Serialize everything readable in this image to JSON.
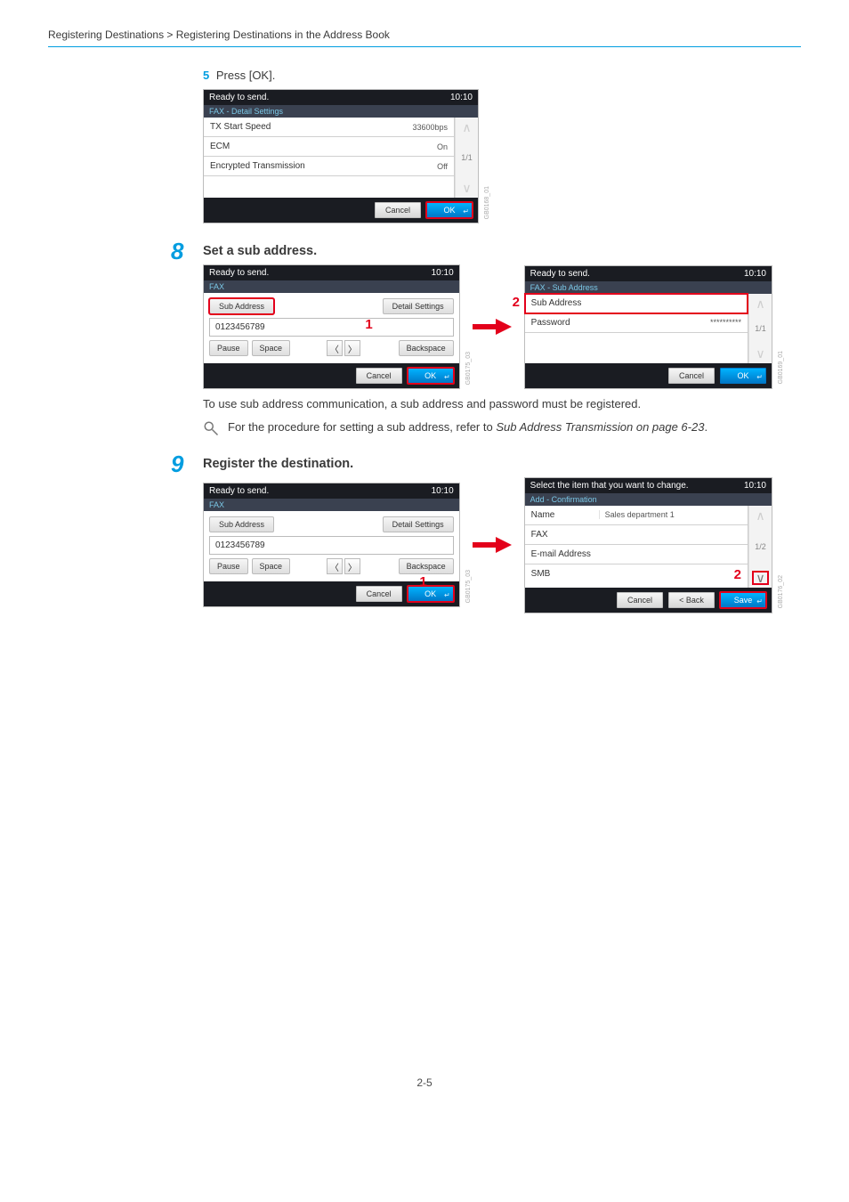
{
  "breadcrumb": "Registering Destinations > Registering Destinations in the Address Book",
  "step5": {
    "num": "5",
    "text": "Press [OK]."
  },
  "panelA": {
    "status": "Ready to send.",
    "time": "10:10",
    "subtitle": "FAX - Detail Settings",
    "rows": [
      {
        "label": "TX Start Speed",
        "value": "33600bps"
      },
      {
        "label": "ECM",
        "value": "On"
      },
      {
        "label": "Encrypted Transmission",
        "value": "Off"
      }
    ],
    "page": "1/1",
    "cancel": "Cancel",
    "ok": "OK",
    "side_tag": "GB0168_01"
  },
  "step8": {
    "num": "8",
    "title": "Set a sub address."
  },
  "panelB": {
    "status": "Ready to send.",
    "time": "10:10",
    "subtitle": "FAX",
    "tab_sub": "Sub Address",
    "tab_detail": "Detail Settings",
    "input": "0123456789",
    "pause": "Pause",
    "space": "Space",
    "backspace": "Backspace",
    "cancel": "Cancel",
    "ok": "OK",
    "side_tag": "GB0175_03",
    "callout": "1"
  },
  "panelC": {
    "status": "Ready to send.",
    "time": "10:10",
    "subtitle": "FAX - Sub Address",
    "rows": [
      {
        "label": "Sub Address",
        "value": ""
      },
      {
        "label": "Password",
        "value": "**********"
      }
    ],
    "page": "1/1",
    "cancel": "Cancel",
    "ok": "OK",
    "side_tag": "GB0169_01",
    "callout": "2"
  },
  "note8": "To use sub address communication, a sub address and password must be registered.",
  "ref8_a": "For the procedure for setting a sub address, refer to ",
  "ref8_b": "Sub Address Transmission on page 6-23",
  "ref8_c": ".",
  "step9": {
    "num": "9",
    "title": "Register the destination."
  },
  "panelD": {
    "status": "Ready to send.",
    "time": "10:10",
    "subtitle": "FAX",
    "tab_sub": "Sub Address",
    "tab_detail": "Detail Settings",
    "input": "0123456789",
    "pause": "Pause",
    "space": "Space",
    "backspace": "Backspace",
    "cancel": "Cancel",
    "ok": "OK",
    "side_tag": "GB0175_03",
    "callout": "1"
  },
  "panelE": {
    "status": "Select the item that you want to change.",
    "time": "10:10",
    "subtitle": "Add - Confirmation",
    "rows": [
      {
        "label": "Name",
        "value": "Sales department 1"
      },
      {
        "label": "FAX",
        "value": ""
      },
      {
        "label": "E-mail Address",
        "value": ""
      },
      {
        "label": "SMB",
        "value": ""
      }
    ],
    "page": "1/2",
    "cancel": "Cancel",
    "back": "< Back",
    "save": "Save",
    "side_tag": "GB0176_02",
    "callout": "2"
  },
  "page_no": "2-5"
}
